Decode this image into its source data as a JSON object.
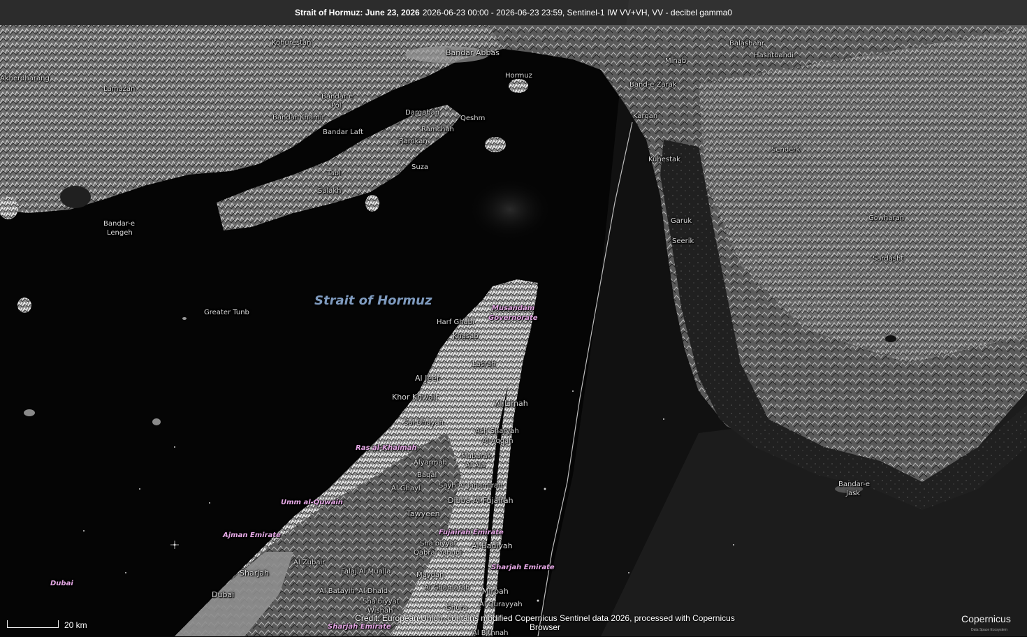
{
  "header": {
    "title_bold": "Strait of Hormuz: June 23, 2026",
    "title_rest": "2026-06-23 00:00 - 2026-06-23 23:59, Sentinel-1 IW VV+VH, VV - decibel gamma0"
  },
  "scale": {
    "label": "20 km"
  },
  "credit": {
    "line1": "Credit: European Union, contains modified Copernicus Sentinel data 2026, processed with Copernicus",
    "line2": "Browser"
  },
  "logo": {
    "text": "Copernicus",
    "sub": "Data Space Ecosystem"
  },
  "labels": {
    "water": "Strait of Hormuz",
    "kohurestan": "Kohurestan",
    "bandar_abbas": "Bandar Abbas",
    "hormuz": "Hormuz",
    "minab": "Minab",
    "balashahr": "Balashahr",
    "hashtbandi": "Hashtbandi",
    "kherdharang": "Akherdharang",
    "lamazan": "Lamazan",
    "bandar_e_pol_1": "Bandar e",
    "bandar_e_pol_2": "Pol",
    "bandar_khamir": "Bandar Khamir",
    "bandar_laft": "Bandar Laft",
    "dargahan": "Dargahan",
    "qeshm": "Qeshm",
    "ramchah": "Ramchah",
    "ramkan": "Ramkan",
    "suza": "Suza",
    "tabl": "Tabl",
    "salakh": "Salakh",
    "band_e_zarak": "Band-e Zarak",
    "kargan": "Kargan",
    "kuhestak": "Kuhestak",
    "senderk": "Senderk",
    "gowharan": "Gowharan",
    "sardasht": "Sardasht",
    "garuk": "Garuk",
    "seerik": "Seerik",
    "bandar_e_lengeh_1": "Bandar-e",
    "bandar_e_lengeh_2": "Lengeh",
    "greater_tunb": "Greater Tunb",
    "musandam_1": "Musandam",
    "musandam_2": "Governorate",
    "harf_ghabi": "Harf Ghabi",
    "khasab": "Khasab",
    "lasrah": "Lasrah",
    "al_jeer": "Al Jeer",
    "khor_khwair": "Khor Khwair",
    "al_limah": "Al Limah",
    "sal_dhayah": "Sal Dhayah",
    "ash_sharyah": "Ash Sharyah",
    "al_aqqah": "Al Aqqah",
    "ras_al_khaimah": "Ras al-Khaimah",
    "mubarak": "Mubarak",
    "al_ala": "Al Ala",
    "alyarmah": "Alyarmah",
    "baqal": "Baqal",
    "al_ghayl": "Al Ghayl",
    "sayh_al_jahamirah": "Sayh Al Jahamirah",
    "dibba": "Dibba Al Fujairah",
    "umm_al_quwain": "Umm al-Quwain",
    "tawyeen": "Tawyeen",
    "fujairah_emirate": "Fujairah Emirate",
    "ajman_emirate": "Ajman Emirate",
    "shabiyyat": "Sha'biyyat",
    "qabral_yahudi": "Qabral Yahudi",
    "al_badiyah": "Al Badiyah",
    "al_zubair": "Al Zubair",
    "sharjah_emirate": "Sharjah Emirate",
    "sharjah": "Sharjah",
    "falaj_al_mualla": "Falaj Al Mualla",
    "maydan": "Maydan",
    "dubai_label": "Dubai",
    "al_ghamarah": "Al Ghamarah",
    "al_batayih": "Al Batayih",
    "al_dhaid": "Al Dhaid",
    "mirbah": "Mirbah",
    "dubai": "Dubai",
    "shabiyyat_2": "Sha'biyyat",
    "wishah": "Wishah",
    "ghura": "Ghura",
    "al_qurayyah": "Al Qurayyah",
    "sharjah_emirate_2": "Sharjah Emirate",
    "al_bithnah": "Al Bithnah",
    "bandar_e_jask_1": "Bandar-e",
    "bandar_e_jask_2": "Jask"
  }
}
